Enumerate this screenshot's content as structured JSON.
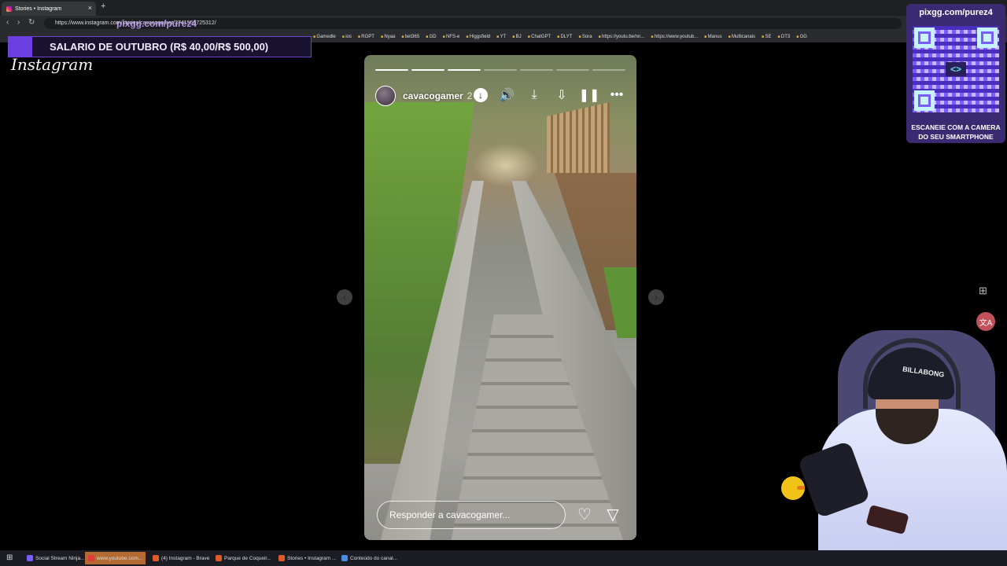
{
  "browser": {
    "tab_title": "Stories • Instagram",
    "url": "https://www.instagram.com/stories/cavacogamer/3741555725312/",
    "url_overlay": "pixgg.com/purez4",
    "bookmarks": [
      "Gamedle",
      "ios",
      "RGPT",
      "Nyaa",
      "bet365",
      "GD",
      "NFS-e",
      "Higgsfield",
      "YT",
      "BJ",
      "ChatGPT",
      "DLYT",
      "Sora",
      "https://youtu.be/nn...",
      "https://www.youtub...",
      "Manus",
      "Multicanais",
      "SE",
      "DT3",
      "GG"
    ]
  },
  "salary_banner": "SALARIO DE OUTUBRO (R$ 40,00/R$ 500,00)",
  "instagram_logo": "Instagram",
  "story": {
    "username": "cavacogamer",
    "time": "2",
    "segments_total": 7,
    "segments_done": 3,
    "reply_placeholder": "Responder a cavacogamer..."
  },
  "qr_panel": {
    "title": "pixgg.com/purez4",
    "footer_line1": "ESCANEIE COM A CAMERA",
    "footer_line2": "DO SEU SMARTPHONE"
  },
  "webcam": {
    "cap_text": "BILLABONG"
  },
  "taskbar": {
    "items": [
      {
        "label": "Social Stream Ninja..."
      },
      {
        "label": "www.youtube.com..."
      },
      {
        "label": "(4) Instagram - Brave"
      },
      {
        "label": "Parque de Coqueir..."
      },
      {
        "label": "Stories • Instagram ..."
      },
      {
        "label": "Conteúdo do canal..."
      }
    ]
  },
  "colors": {
    "banner_accent": "#6a3ee0",
    "qr_panel_bg": "#3a2a72",
    "taskbar_active": "#b36a33"
  }
}
